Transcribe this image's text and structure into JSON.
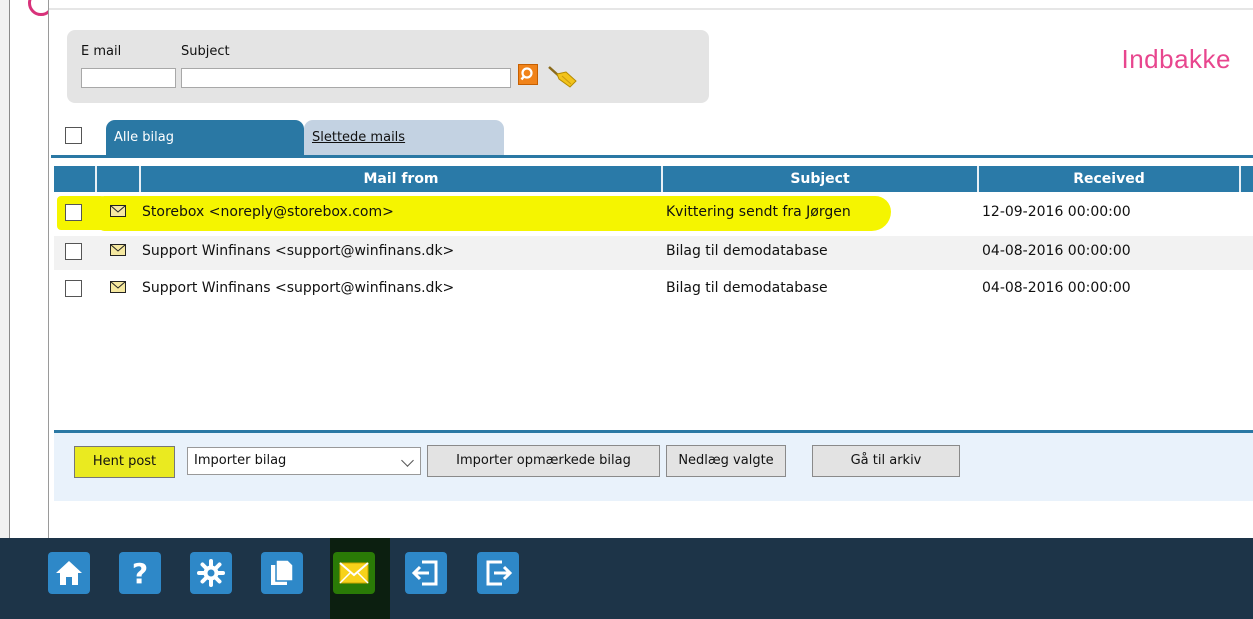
{
  "search": {
    "email_label": "E mail",
    "subject_label": "Subject",
    "email_value": "",
    "subject_value": ""
  },
  "page_title": "Indbakke",
  "tabs": [
    {
      "label": "Alle bilag",
      "active": true
    },
    {
      "label": "Slettede mails",
      "active": false
    }
  ],
  "table": {
    "columns": [
      "Mail from",
      "Subject",
      "Received"
    ],
    "rows": [
      {
        "from": "Storebox <noreply@storebox.com>",
        "subject": "Kvittering sendt fra Jørgen",
        "received": "12-09-2016 00:00:00"
      },
      {
        "from": "Support Winfinans <support@winfinans.dk>",
        "subject": "Bilag til demodatabase",
        "received": "04-08-2016 00:00:00"
      },
      {
        "from": "Support Winfinans <support@winfinans.dk>",
        "subject": "Bilag til demodatabase",
        "received": "04-08-2016 00:00:00"
      }
    ]
  },
  "footer": {
    "fetch_button": "Hent post",
    "import_select": "Importer bilag",
    "import_marked_button": "Importer opmærkede bilag",
    "delete_selected_button": "Nedlæg valgte",
    "archive_button": "Gå til arkiv"
  },
  "taskbar": {
    "icons": [
      "home-icon",
      "help-icon",
      "settings-icon",
      "documents-icon",
      "mail-icon",
      "login-icon",
      "logout-icon"
    ],
    "active": "mail-icon"
  },
  "colors": {
    "accent": "#2a78a4",
    "title": "#e8468e",
    "highlight": "#f5f500",
    "taskbar": "#1d3448",
    "taskbar_button": "#2e88c8",
    "active_button": "#2a7a06"
  }
}
